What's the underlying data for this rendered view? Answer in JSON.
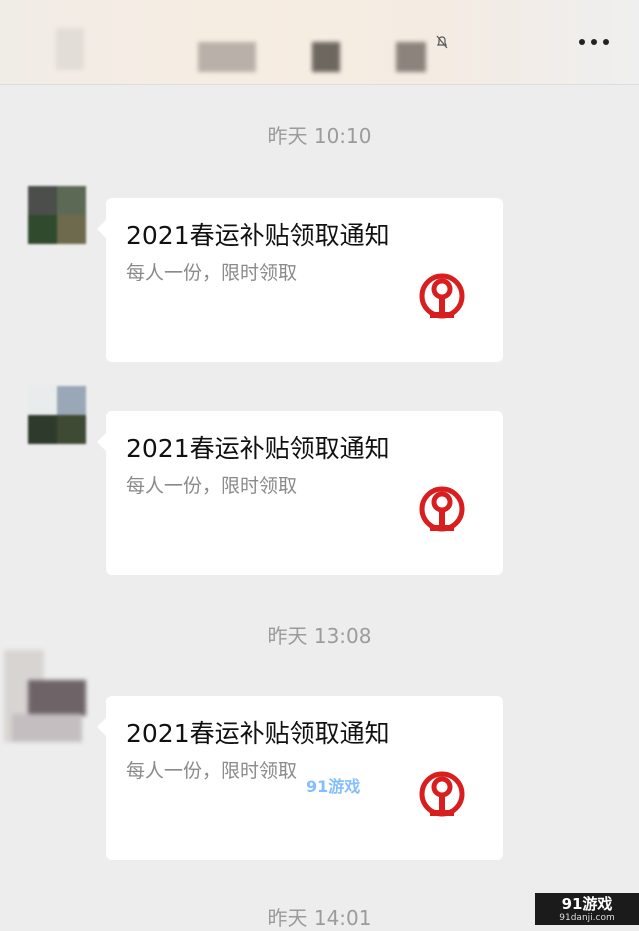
{
  "header": {
    "more_icon": "more-dots-icon",
    "mute_icon": "bell-muted-icon"
  },
  "timestamps": [
    "昨天 10:10",
    "昨天 13:08",
    "昨天 14:01"
  ],
  "messages": [
    {
      "title": "2021春运补贴领取通知",
      "desc": "每人一份，限时领取",
      "logo": "china-railway-logo"
    },
    {
      "title": "2021春运补贴领取通知",
      "desc": "每人一份，限时领取",
      "logo": "china-railway-logo"
    },
    {
      "title": "2021春运补贴领取通知",
      "desc": "每人一份，限时领取",
      "logo": "china-railway-logo"
    }
  ],
  "watermark": {
    "mid": "91游戏",
    "corner_top": "91游戏",
    "corner_bottom": "91danji.com"
  },
  "colors": {
    "background": "#ededed",
    "card": "#ffffff",
    "railway_red": "#d81e1e",
    "timestamp": "#9b9b9b"
  }
}
